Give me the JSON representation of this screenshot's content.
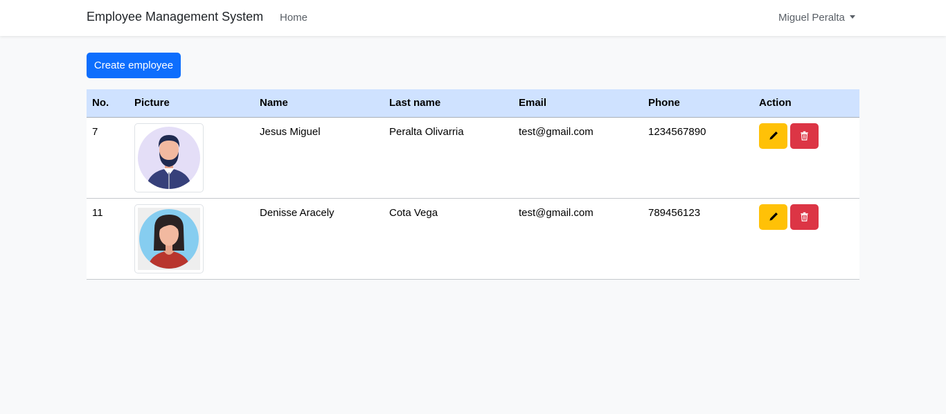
{
  "navbar": {
    "brand": "Employee Management System",
    "home_label": "Home",
    "user_name": "Miguel Peralta"
  },
  "toolbar": {
    "create_label": "Create employee"
  },
  "table": {
    "headers": [
      "No.",
      "Picture",
      "Name",
      "Last name",
      "Email",
      "Phone",
      "Action"
    ],
    "rows": [
      {
        "no": "7",
        "avatar": "male-avatar-icon",
        "name": "Jesus Miguel",
        "last_name": "Peralta Olivarria",
        "email": "test@gmail.com",
        "phone": "1234567890"
      },
      {
        "no": "11",
        "avatar": "female-avatar-icon",
        "name": "Denisse Aracely",
        "last_name": "Cota Vega",
        "email": "test@gmail.com",
        "phone": "789456123"
      }
    ]
  },
  "colors": {
    "primary": "#0d6efd",
    "warning": "#ffc107",
    "danger": "#dc3545",
    "table_header": "#cfe2ff"
  }
}
